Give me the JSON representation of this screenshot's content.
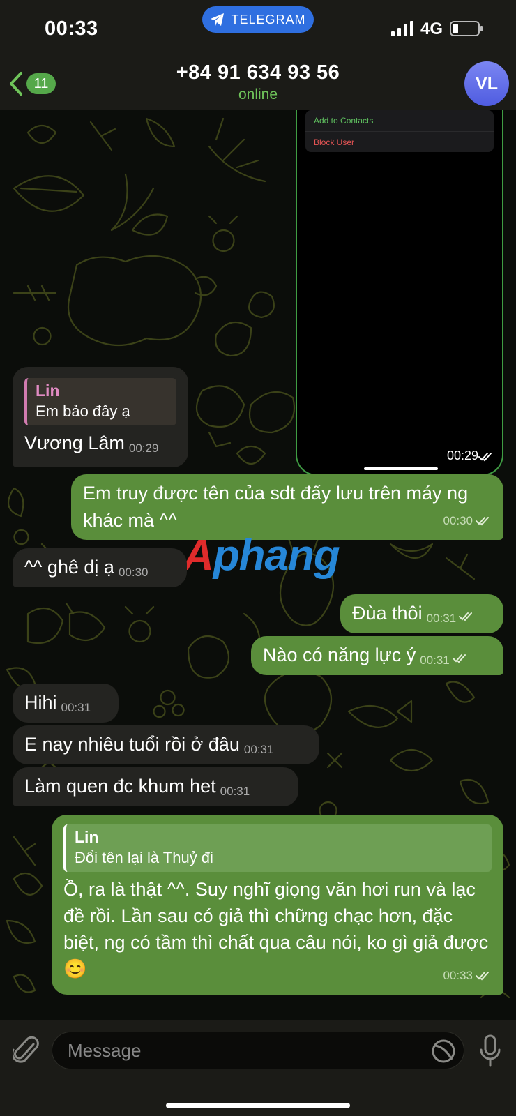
{
  "status_bar": {
    "time": "00:33",
    "app_pill": "TELEGRAM",
    "network": "4G"
  },
  "header": {
    "back_badge": "11",
    "title": "+84 91 634 93 56",
    "subtitle": "online",
    "avatar_initials": "VL"
  },
  "screenshot_card": {
    "menu_items": [
      "Add to Contacts",
      "Block User"
    ],
    "time": "00:29"
  },
  "messages": [
    {
      "dir": "in",
      "reply_name": "Lin",
      "reply_text": "Em bảo đây ạ",
      "text": "Vương Lâm",
      "time": "00:29"
    },
    {
      "dir": "out",
      "text": "Em truy được tên của sdt đấy lưu trên máy ng khác mà ^^",
      "time": "00:30"
    },
    {
      "dir": "in",
      "text": "^^ ghê dị ạ",
      "time": "00:30"
    },
    {
      "dir": "out",
      "text": "Đùa thôi",
      "time": "00:31"
    },
    {
      "dir": "out",
      "text": "Nào có năng lực ý",
      "time": "00:31"
    },
    {
      "dir": "in",
      "text": "Hihi",
      "time": "00:31"
    },
    {
      "dir": "in",
      "text": "E nay nhiêu tuổi rồi ở đâu",
      "time": "00:31"
    },
    {
      "dir": "in",
      "text": "Làm quen đc khum het",
      "time": "00:31"
    },
    {
      "dir": "out",
      "reply_name": "Lin",
      "reply_text": "Đổi tên lại là Thuỷ đi",
      "text": "Ồ, ra là thật ^^. Suy nghĩ giọng văn hơi run và lạc đề rồi. Lần sau có giả thì chững chạc hơn, đặc biệt, ng có tầm thì chất qua câu nói, ko gì giả được 😊",
      "time": "00:33"
    }
  ],
  "watermark": {
    "first": "A",
    "rest": "phang"
  },
  "input": {
    "placeholder": "Message"
  },
  "colors": {
    "accent_green": "#5a8e3b",
    "online_green": "#6fc45a",
    "telegram_blue": "#2f6fe0",
    "avatar_purple": "#6b76ee",
    "incoming_bubble": "#242421"
  },
  "icons": [
    "back-chevron-icon",
    "telegram-plane-icon",
    "signal-icon",
    "battery-icon",
    "double-check-icon",
    "paperclip-icon",
    "sticker-icon",
    "microphone-icon"
  ]
}
